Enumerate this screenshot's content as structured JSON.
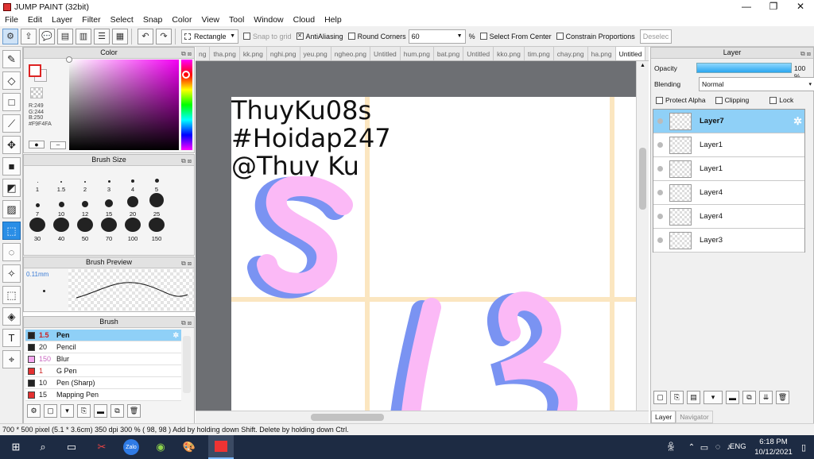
{
  "window": {
    "title": "JUMP PAINT (32bit)",
    "controls": [
      "—",
      "❐",
      "✕"
    ]
  },
  "menu": [
    "File",
    "Edit",
    "Layer",
    "Filter",
    "Select",
    "Snap",
    "Color",
    "View",
    "Tool",
    "Window",
    "Cloud",
    "Help"
  ],
  "toolbar": {
    "shape_select": "Rectangle",
    "snap_to_grid": "Snap to grid",
    "antialiasing": "AntiAliasing",
    "round_corners": "Round Corners",
    "round_value": "60",
    "percent": "%",
    "select_from_center": "Select From Center",
    "constrain": "Constrain Proportions",
    "deselect": "Deselec"
  },
  "color_panel": {
    "title": "Color",
    "r": "R:249",
    "g": "G:244",
    "b": "B:250",
    "hex": "#F9F4FA"
  },
  "brush_size_panel": {
    "title": "Brush Size",
    "sizes": [
      "1",
      "1.5",
      "2",
      "3",
      "4",
      "5",
      "7",
      "10",
      "12",
      "15",
      "20",
      "25",
      "30",
      "40",
      "50",
      "70",
      "100",
      "150"
    ]
  },
  "brush_preview_panel": {
    "title": "Brush Preview",
    "size_label": "0.11mm"
  },
  "brush_panel": {
    "title": "Brush",
    "items": [
      {
        "size": "1.5",
        "name": "Pen",
        "color": "#222222"
      },
      {
        "size": "20",
        "name": "Pencil",
        "color": "#222222"
      },
      {
        "size": "150",
        "name": "Blur",
        "color": "#f5a8f0"
      },
      {
        "size": "1",
        "name": "G Pen",
        "color": "#e43030"
      },
      {
        "size": "10",
        "name": "Pen (Sharp)",
        "color": "#222222"
      },
      {
        "size": "15",
        "name": "Mapping Pen",
        "color": "#e43030"
      }
    ]
  },
  "doc_tabs": [
    "ng",
    "tha.png",
    "kk.png",
    "nghi.png",
    "yeu.png",
    "ngheo.png",
    "Untitled",
    "hum.png",
    "bat.png",
    "Untitled",
    "kko.png",
    "tim.png",
    "chay.png",
    "ha.png",
    "Untitled"
  ],
  "canvas_text": {
    "line1": "ThuyKu08s",
    "line2": "#Hoidap247",
    "line3": "@Thụy Ku"
  },
  "layer_panel": {
    "title": "Layer",
    "opacity_label": "Opacity",
    "opacity_value": "100 %",
    "blending_label": "Blending",
    "blending_value": "Normal",
    "protect_alpha": "Protect Alpha",
    "clipping": "Clipping",
    "lock": "Lock",
    "layers": [
      "Layer7",
      "Layer1",
      "Layer1",
      "Layer4",
      "Layer4",
      "Layer3"
    ],
    "footer_tabs": [
      "Layer",
      "Navigator"
    ]
  },
  "status": {
    "text": "700 * 500 pixel   (5.1 * 3.6cm)   350 dpi   300 %   ( 98, 98 )   Add by holding down Shift. Delete by holding down Ctrl."
  },
  "taskbar": {
    "time": "6:18 PM",
    "date": "10/12/2021",
    "lang": "ENG"
  }
}
